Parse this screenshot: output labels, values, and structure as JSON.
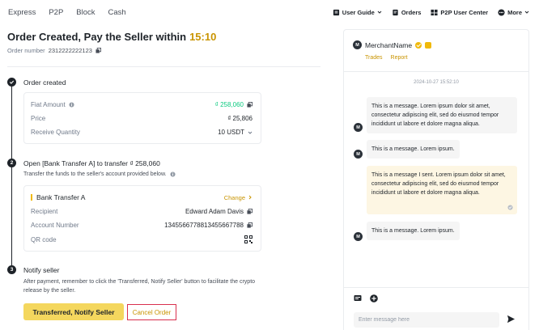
{
  "nav": {
    "left": [
      "Express",
      "P2P",
      "Block",
      "Cash"
    ],
    "right": {
      "user_guide": "User Guide",
      "orders": "Orders",
      "user_center": "P2P User Center",
      "more": "More"
    }
  },
  "order": {
    "title": "Order Created, Pay the Seller within",
    "timer": "15:10",
    "number_label": "Order number",
    "number": "2312222222123"
  },
  "steps": [
    {
      "index": "1",
      "title": "Order created",
      "rows": [
        {
          "label": "Fiat Amount",
          "value": "₫ 258,060"
        },
        {
          "label": "Price",
          "value": "₫ 25,806"
        },
        {
          "label": "Receive Quantity",
          "value": "10 USDT"
        }
      ]
    },
    {
      "index": "2",
      "title": "Open [Bank Transfer A] to transfer ₫ 258,060",
      "subtitle": "Transfer the funds to the seller's account provided below.",
      "bank": {
        "name": "Bank Transfer A",
        "change": "Change",
        "rows": [
          {
            "label": "Recipient",
            "value": "Edward Adam Davis"
          },
          {
            "label": "Account Number",
            "value": "1345566778813455667788"
          },
          {
            "label": "QR code",
            "value": ""
          }
        ]
      }
    },
    {
      "index": "3",
      "title": "Notify seller",
      "subtitle": "After payment, remember to click the 'Transferred, Notify Seller' button to facilitate the crypto release by the seller."
    }
  ],
  "actions": {
    "notify": "Transferred, Notify Seller",
    "cancel": "Cancel Order"
  },
  "chat": {
    "merchant_name": "MerchantName",
    "avatar_letter": "M",
    "links": [
      "Trades",
      "Report"
    ],
    "timestamp": "2024-10-27 15:52:10",
    "messages": [
      {
        "from": "merchant",
        "text": "This is a message. Lorem ipsum dolor sit amet, consectetur adipiscing elit, sed do eiusmod tempor incididunt ut labore et dolore magna aliqua."
      },
      {
        "from": "merchant",
        "text": "This is a message. Lorem ipsum."
      },
      {
        "from": "me",
        "text": "This is a message I sent. Lorem ipsum dolor sit amet, consectetur adipiscing elit, sed do eiusmod tempor incididunt ut labore et dolore magna aliqua."
      },
      {
        "from": "merchant",
        "text": "This is a message. Lorem ipsum."
      }
    ],
    "input_placeholder": "Enter message here"
  },
  "colors": {
    "accent": "#c99400",
    "primary_button": "#f4d75e",
    "green": "#0ecb81",
    "cancel_border": "#d9304e"
  }
}
